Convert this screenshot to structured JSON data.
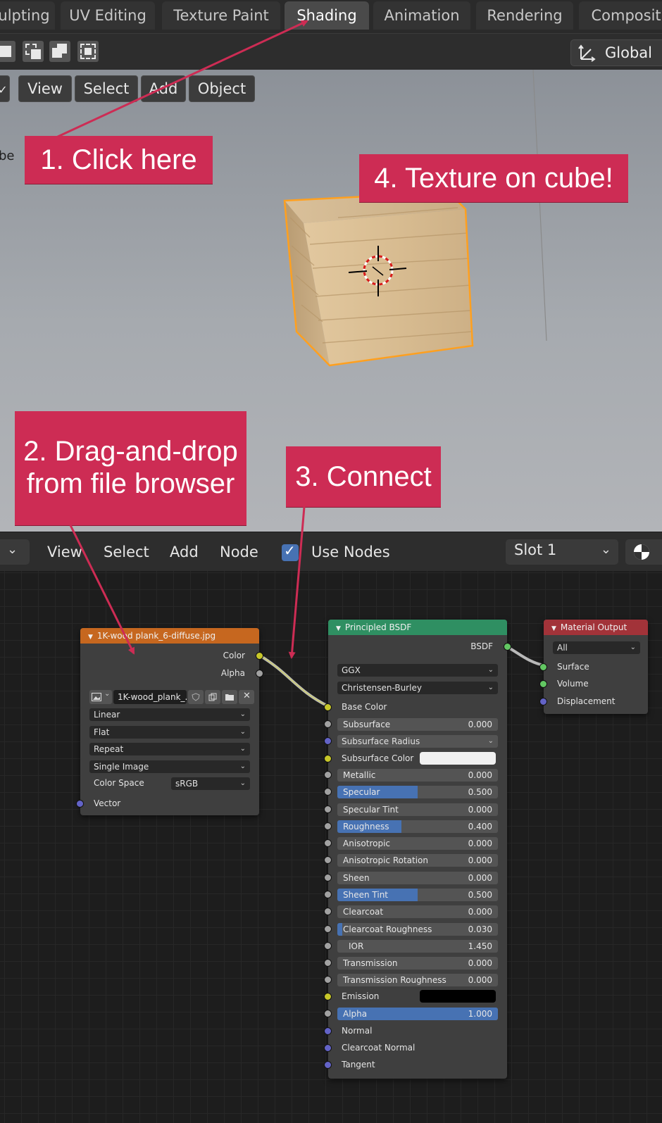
{
  "workspace_tabs": [
    {
      "label": "ulpting"
    },
    {
      "label": "UV Editing"
    },
    {
      "label": "Texture Paint"
    },
    {
      "label": "Shading",
      "active": true
    },
    {
      "label": "Animation"
    },
    {
      "label": "Rendering"
    },
    {
      "label": "Compositi"
    }
  ],
  "viewport_header": {
    "transform_orientation": "Global",
    "select_modes": [
      "set",
      "extend",
      "subtract",
      "intersect"
    ]
  },
  "viewport_menu": [
    "View",
    "Select",
    "Add",
    "Object"
  ],
  "viewport": {
    "object_label_fragment": "be"
  },
  "callouts": [
    {
      "text": "1. Click here"
    },
    {
      "text": "2. Drag-and-drop\nfrom file browser"
    },
    {
      "text": "3. Connect"
    },
    {
      "text": "4. Texture on cube!"
    }
  ],
  "node_header": {
    "menus": [
      "View",
      "Select",
      "Add",
      "Node"
    ],
    "use_nodes_label": "Use Nodes",
    "use_nodes_checked": true,
    "slot": "Slot 1"
  },
  "image_node": {
    "title": "1K-wood plank_6-diffuse.jpg",
    "outputs": [
      "Color",
      "Alpha"
    ],
    "image_name": "1K-wood_plank_...",
    "interpolation": "Linear",
    "projection": "Flat",
    "extension": "Repeat",
    "source": "Single Image",
    "color_space_label": "Color Space",
    "color_space": "sRGB",
    "input": "Vector"
  },
  "bsdf_node": {
    "title": "Principled BSDF",
    "output": "BSDF",
    "distribution": "GGX",
    "subsurface_method": "Christensen-Burley",
    "base_color_label": "Base Color",
    "subsurface": {
      "label": "Subsurface",
      "value": "0.000",
      "fraction": 0.0
    },
    "subsurface_radius": "Subsurface Radius",
    "subsurface_color_label": "Subsurface Color",
    "subsurface_color": "#f0f0f0",
    "metallic": {
      "label": "Metallic",
      "value": "0.000",
      "fraction": 0.0
    },
    "specular": {
      "label": "Specular",
      "value": "0.500",
      "fraction": 0.5
    },
    "specular_tint": {
      "label": "Specular Tint",
      "value": "0.000",
      "fraction": 0.0
    },
    "roughness": {
      "label": "Roughness",
      "value": "0.400",
      "fraction": 0.4
    },
    "anisotropic": {
      "label": "Anisotropic",
      "value": "0.000",
      "fraction": 0.0
    },
    "anisotropic_rotation": {
      "label": "Anisotropic Rotation",
      "value": "0.000",
      "fraction": 0.0
    },
    "sheen": {
      "label": "Sheen",
      "value": "0.000",
      "fraction": 0.0
    },
    "sheen_tint": {
      "label": "Sheen Tint",
      "value": "0.500",
      "fraction": 0.5
    },
    "clearcoat": {
      "label": "Clearcoat",
      "value": "0.000",
      "fraction": 0.0
    },
    "clearcoat_roughness": {
      "label": "Clearcoat Roughness",
      "value": "0.030",
      "fraction": 0.03
    },
    "ior": {
      "label": "IOR",
      "value": "1.450"
    },
    "transmission": {
      "label": "Transmission",
      "value": "0.000",
      "fraction": 0.0
    },
    "transmission_roughness": {
      "label": "Transmission Roughness",
      "value": "0.000",
      "fraction": 0.0
    },
    "emission_label": "Emission",
    "emission_color": "#000000",
    "alpha": {
      "label": "Alpha",
      "value": "1.000",
      "fraction": 1.0
    },
    "normal_label": "Normal",
    "clearcoat_normal_label": "Clearcoat Normal",
    "tangent_label": "Tangent"
  },
  "output_node": {
    "title": "Material Output",
    "target": "All",
    "inputs": [
      "Surface",
      "Volume",
      "Displacement"
    ]
  },
  "colors": {
    "callout": "#cd2c54",
    "image_node_header": "#c6671f",
    "bsdf_node_header": "#2f8f62",
    "output_node_header": "#a23339",
    "slider_fill": "#4772b3",
    "selection_outline": "#ffa01f"
  }
}
